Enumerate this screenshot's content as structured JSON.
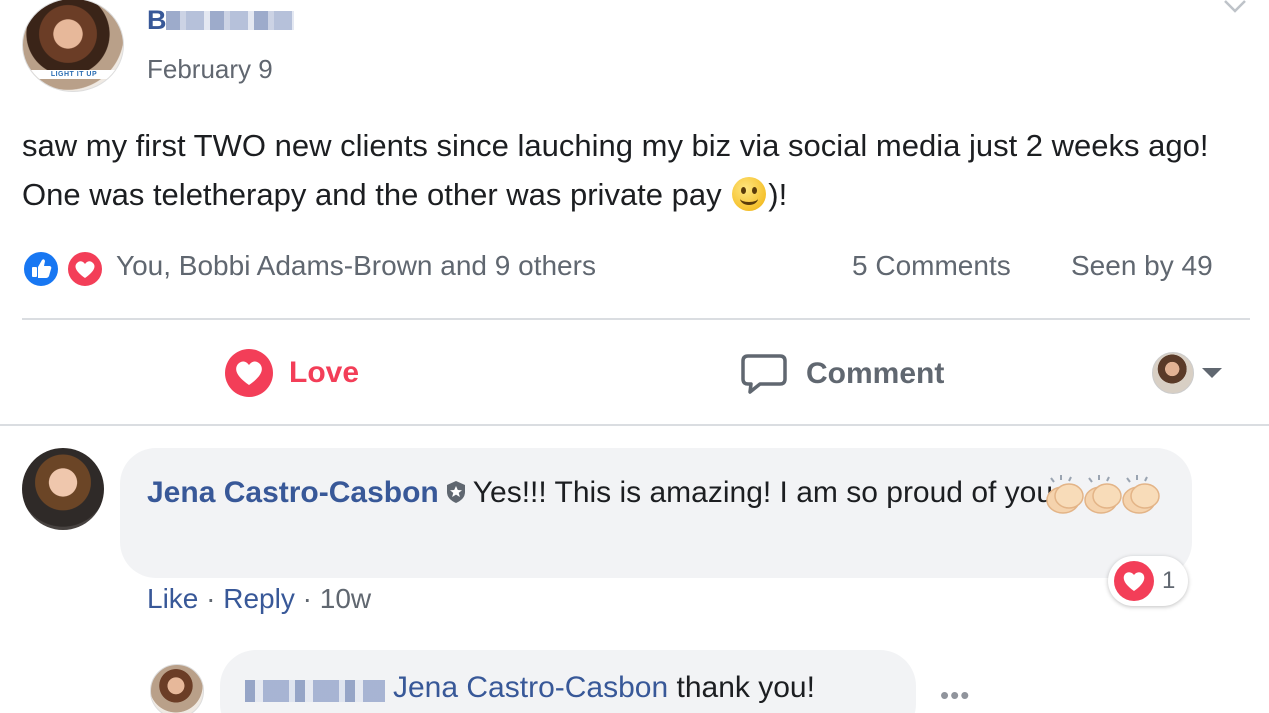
{
  "post": {
    "author": "B",
    "date": "February 9",
    "avatar_logo_text": "LIGHT IT UP",
    "text_before_emoji": "saw my first TWO new clients since lauching my biz via social media just 2 weeks ago! One was teletherapy and the other was private pay ",
    "emoji": "slightly-smiling-face",
    "text_after_emoji": ")!"
  },
  "reactions": {
    "icons": [
      "like-icon",
      "love-icon"
    ],
    "names": "You, Bobbi Adams-Brown and 9 others",
    "comments": "5 Comments",
    "seen_by": "Seen by 49"
  },
  "actions": {
    "love": "Love",
    "comment": "Comment"
  },
  "comment": {
    "author": "Jena Castro-Casbon",
    "text": "Yes!!! This is amazing! I am so proud of you",
    "emojis": [
      "clapping-hands",
      "clapping-hands",
      "clapping-hands"
    ],
    "reaction_count": "1",
    "like": "Like",
    "reply": "Reply",
    "time": "10w",
    "separator": " · "
  },
  "reply": {
    "mention": "Jena Castro-Casbon",
    "text": " thank you!",
    "more": "•••"
  },
  "colors": {
    "link_blue": "#385898",
    "love_red": "#f33e58",
    "like_blue": "#1877f2",
    "muted": "#606770",
    "bubble_bg": "#f2f3f5"
  }
}
